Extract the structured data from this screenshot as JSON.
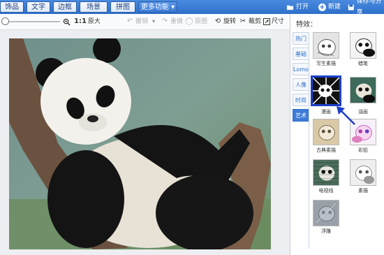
{
  "tabs": [
    "饰品",
    "文字",
    "边框",
    "场景",
    "拼图",
    "更多功能"
  ],
  "tab_more_arrow": "▾",
  "top_right": {
    "open": "打开",
    "new": "新建",
    "save": "保存与分享"
  },
  "toolbar": {
    "zoom_value": "1:1",
    "zoom_label": "原大",
    "undo": "撤销",
    "redo": "重做",
    "reset": "原图",
    "rotate": "旋转",
    "crop": "裁剪",
    "resize": "尺寸"
  },
  "panel": {
    "title": "特效：",
    "categories": [
      "热门",
      "基础",
      "Lomo",
      "人像",
      "时尚",
      "艺术"
    ],
    "active_category": "艺术",
    "effects": [
      "写生素描",
      "蜡笔",
      "漫画",
      "油画",
      "古典素描",
      "彩铅",
      "电视线",
      "素描",
      "浮雕"
    ],
    "selected_effect": "漫画"
  },
  "colors": {
    "accent": "#2e6fc9",
    "selected": "#1c3fc8"
  },
  "icons": [
    "zoom-in-icon",
    "undo-icon",
    "redo-icon",
    "reset-icon",
    "rotate-icon",
    "crop-icon",
    "resize-icon",
    "open-folder-icon",
    "new-plus-icon",
    "save-icon"
  ]
}
